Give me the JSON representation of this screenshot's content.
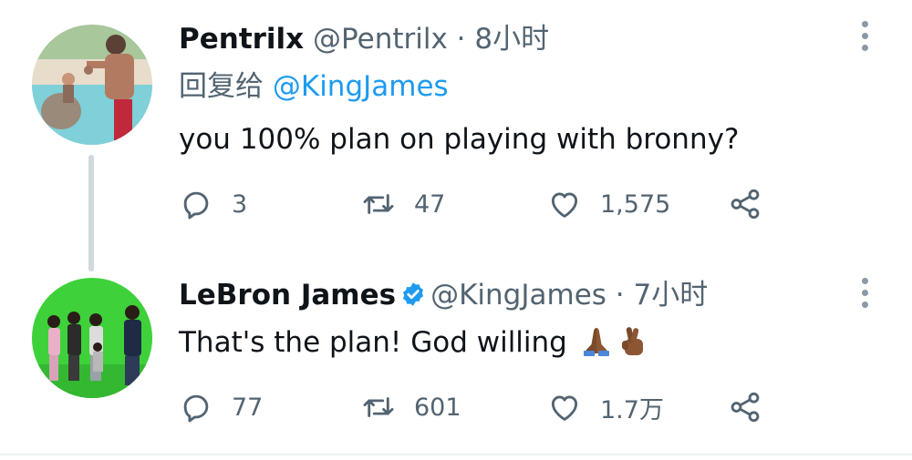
{
  "tweets": [
    {
      "display_name": "Pentrilx",
      "handle": "@Pentrilx",
      "separator": "·",
      "time": "8小时",
      "reply_prefix": "回复给",
      "reply_mention": "@KingJames",
      "text": "you 100% plan on playing with bronny?",
      "reply_count": "3",
      "retweet_count": "47",
      "like_count": "1,575",
      "avatar_icon": "beach-photo-avatar"
    },
    {
      "display_name": "LeBron James",
      "verified": true,
      "verified_icon": "verified-badge-icon",
      "handle": "@KingJames",
      "separator": "·",
      "time": "7小时",
      "text": "That's the plan! God willing",
      "emojis": [
        "folded-hands-emoji",
        "crossed-fingers-emoji"
      ],
      "reply_count": "77",
      "retweet_count": "601",
      "like_count": "1.7万",
      "avatar_icon": "green-screen-photo-avatar"
    }
  ],
  "colors": {
    "text_primary": "#0f1419",
    "text_secondary": "#536471",
    "link": "#1d9bf0",
    "verified": "#1d9bf0",
    "thread_line": "#cfd9de",
    "divider": "#eff3f4"
  }
}
